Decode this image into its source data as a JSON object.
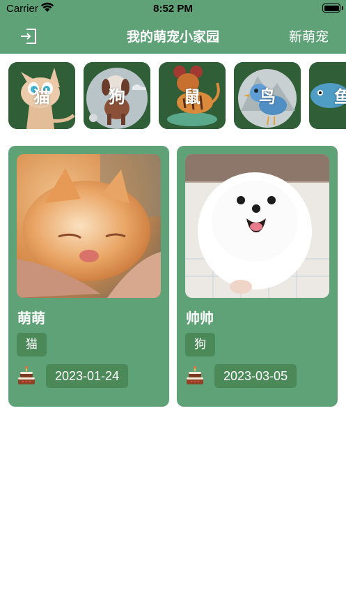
{
  "status_bar": {
    "carrier": "Carrier",
    "time": "8:52 PM",
    "icons": [
      "wifi-icon",
      "battery-icon"
    ]
  },
  "nav": {
    "title": "我的萌宠小家园",
    "action_label": "新萌宠",
    "left_icon": "logout-icon"
  },
  "categories": [
    {
      "label": "猫",
      "art": "cat-illustration"
    },
    {
      "label": "狗",
      "art": "dog-illustration"
    },
    {
      "label": "鼠",
      "art": "mouse-illustration"
    },
    {
      "label": "鸟",
      "art": "bird-illustration"
    },
    {
      "label": "鱼",
      "art": "fish-illustration"
    }
  ],
  "pets": [
    {
      "name": "萌萌",
      "type": "猫",
      "birthday": "2023-01-24",
      "photo": "orange-kitten-photo"
    },
    {
      "name": "帅帅",
      "type": "狗",
      "birthday": "2023-03-05",
      "photo": "white-pomeranian-photo"
    }
  ],
  "colors": {
    "primary_green": "#5fa278",
    "tag_green": "#4b8a58",
    "category_bg": "#2f5e37"
  }
}
